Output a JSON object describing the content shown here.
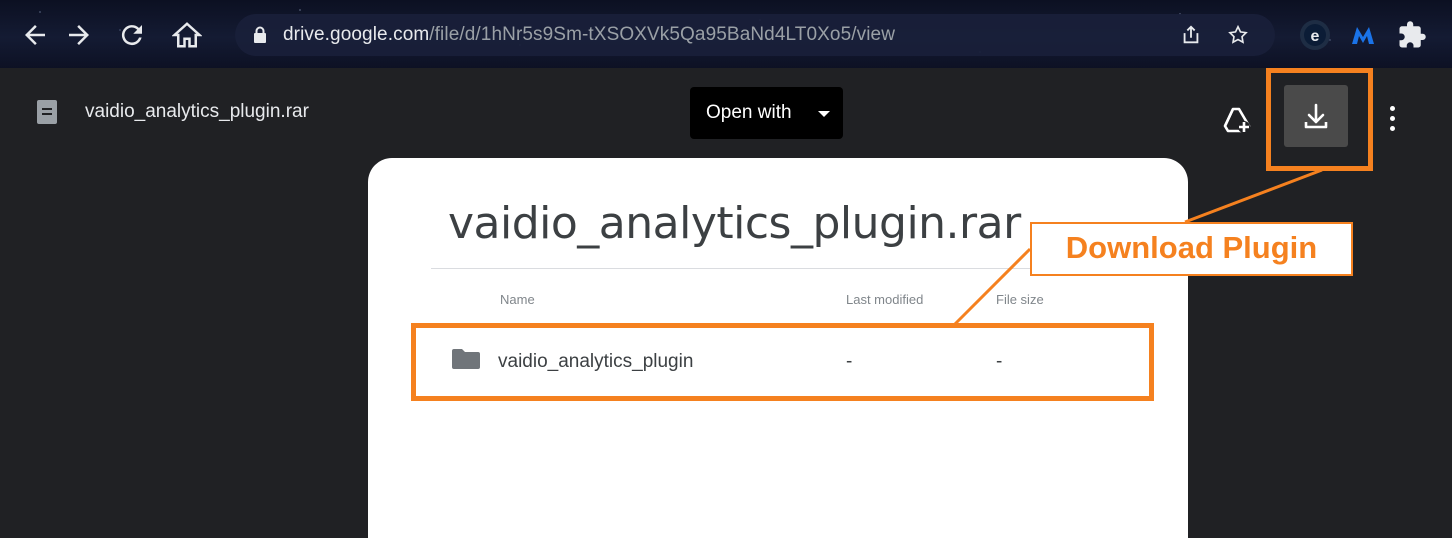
{
  "browser": {
    "url_domain": "drive.google.com",
    "url_path": "/file/d/1hNr5s9Sm-tXSOXVk5Qa95BaNd4LT0Xo5/view",
    "icons": [
      "back-icon",
      "forward-icon",
      "reload-icon",
      "home-icon",
      "lock-icon",
      "share-icon",
      "star-icon",
      "extension-e-icon",
      "extension-m-icon",
      "extensions-puzzle-icon"
    ]
  },
  "viewer": {
    "file_name": "vaidio_analytics_plugin.rar",
    "open_with_label": "Open with",
    "icons": [
      "archive-file-icon",
      "add-to-drive-icon",
      "download-icon",
      "more-vert-icon"
    ]
  },
  "preview": {
    "title": "vaidio_analytics_plugin.rar",
    "columns": {
      "name": "Name",
      "last_modified": "Last modified",
      "file_size": "File size"
    },
    "rows": [
      {
        "icon": "folder-icon",
        "name": "vaidio_analytics_plugin",
        "last_modified": "-",
        "file_size": "-"
      }
    ]
  },
  "annotation": {
    "callout_text": "Download Plugin",
    "color": "#f5811f"
  }
}
